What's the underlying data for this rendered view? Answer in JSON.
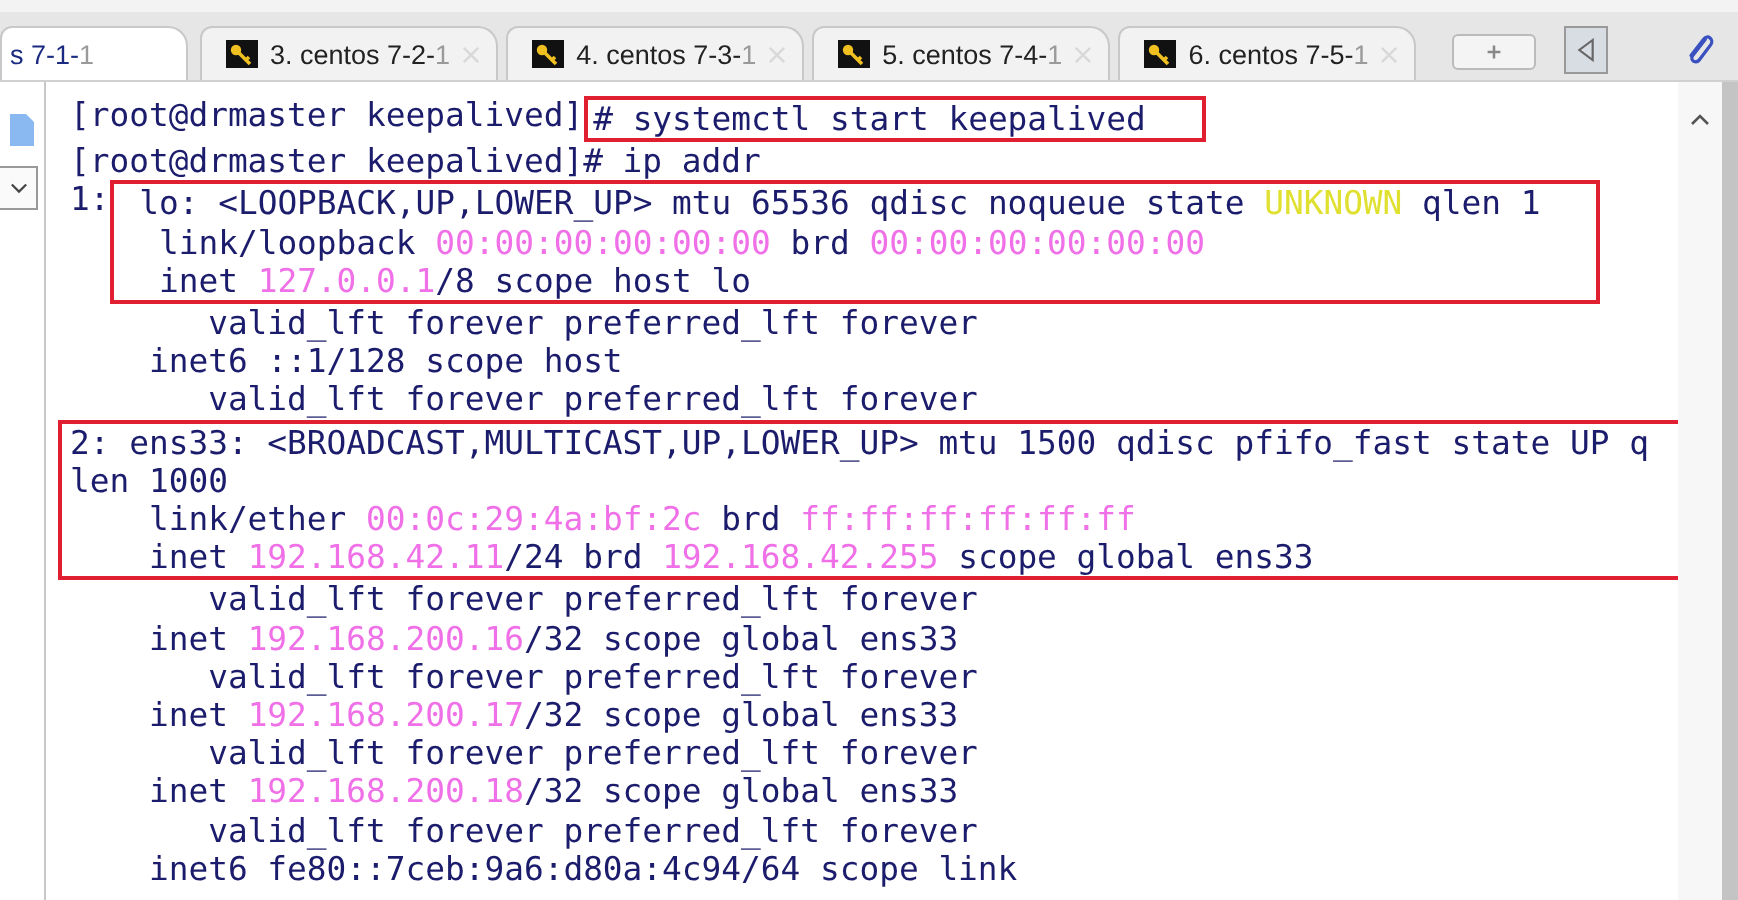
{
  "tabs": [
    {
      "label": "s 7-1-",
      "faded": "1",
      "selected": true,
      "key_icon": false
    },
    {
      "label": "3. centos 7-2-",
      "faded": "1",
      "selected": false,
      "key_icon": true
    },
    {
      "label": "4. centos 7-3-",
      "faded": "1",
      "selected": false,
      "key_icon": true
    },
    {
      "label": "5. centos 7-4-",
      "faded": "1",
      "selected": false,
      "key_icon": true
    },
    {
      "label": "6. centos 7-5-",
      "faded": "1",
      "selected": false,
      "key_icon": true
    }
  ],
  "terminal": {
    "blocks": [
      {
        "highlighted": true,
        "lead": "[root@drmaster keepalived]",
        "lines": [
          [
            {
              "text": "# systemctl start keepalived",
              "kind": "plain"
            }
          ]
        ]
      },
      {
        "highlighted": false,
        "lines": [
          [
            {
              "text": "[root@drmaster keepalived]# ip addr",
              "kind": "plain"
            }
          ]
        ]
      },
      {
        "highlighted": true,
        "lead": "1:",
        "lines": [
          [
            {
              "text": " lo: <LOOPBACK,UP,LOWER_UP> mtu 65536 qdisc noqueue state ",
              "kind": "plain"
            },
            {
              "text": "UNKNOWN",
              "kind": "warn"
            },
            {
              "text": " qlen 1",
              "kind": "plain"
            }
          ],
          [
            {
              "text": "  link/loopback ",
              "kind": "plain"
            },
            {
              "text": "00:00:00:00:00:00",
              "kind": "addr"
            },
            {
              "text": " brd ",
              "kind": "plain"
            },
            {
              "text": "00:00:00:00:00:00",
              "kind": "addr"
            }
          ],
          [
            {
              "text": "  inet ",
              "kind": "plain"
            },
            {
              "text": "127.0.0.1",
              "kind": "addr"
            },
            {
              "text": "/8 scope host lo",
              "kind": "plain"
            }
          ]
        ]
      },
      {
        "highlighted": false,
        "lines": [
          [
            {
              "text": "       valid_lft forever preferred_lft forever",
              "kind": "plain"
            }
          ],
          [
            {
              "text": "    inet6 ::1/128 scope host",
              "kind": "plain"
            }
          ],
          [
            {
              "text": "       valid_lft forever preferred_lft forever",
              "kind": "plain"
            }
          ]
        ]
      },
      {
        "highlighted": true,
        "lines": [
          [
            {
              "text": "2: ens33: <BROADCAST,MULTICAST,UP,LOWER_UP> mtu 1500 qdisc pfifo_fast state UP q",
              "kind": "plain"
            }
          ],
          [
            {
              "text": "len 1000",
              "kind": "plain"
            }
          ],
          [
            {
              "text": "    link/ether ",
              "kind": "plain"
            },
            {
              "text": "00:0c:29:4a:bf:2c",
              "kind": "addr"
            },
            {
              "text": " brd ",
              "kind": "plain"
            },
            {
              "text": "ff:ff:ff:ff:ff:ff",
              "kind": "addr"
            }
          ],
          [
            {
              "text": "    inet ",
              "kind": "plain"
            },
            {
              "text": "192.168.42.11",
              "kind": "addr"
            },
            {
              "text": "/24 brd ",
              "kind": "plain"
            },
            {
              "text": "192.168.42.255",
              "kind": "addr"
            },
            {
              "text": " scope global ens33",
              "kind": "plain"
            }
          ]
        ]
      },
      {
        "highlighted": false,
        "lines": [
          [
            {
              "text": "       valid_lft forever preferred_lft forever",
              "kind": "plain"
            }
          ],
          [
            {
              "text": "    inet ",
              "kind": "plain"
            },
            {
              "text": "192.168.200.16",
              "kind": "addr"
            },
            {
              "text": "/32 scope global ens33",
              "kind": "plain"
            }
          ],
          [
            {
              "text": "       valid_lft forever preferred_lft forever",
              "kind": "plain"
            }
          ],
          [
            {
              "text": "    inet ",
              "kind": "plain"
            },
            {
              "text": "192.168.200.17",
              "kind": "addr"
            },
            {
              "text": "/32 scope global ens33",
              "kind": "plain"
            }
          ],
          [
            {
              "text": "       valid_lft forever preferred_lft forever",
              "kind": "plain"
            }
          ],
          [
            {
              "text": "    inet ",
              "kind": "plain"
            },
            {
              "text": "192.168.200.18",
              "kind": "addr"
            },
            {
              "text": "/32 scope global ens33",
              "kind": "plain"
            }
          ],
          [
            {
              "text": "       valid_lft forever preferred_lft forever",
              "kind": "plain"
            }
          ],
          [
            {
              "text": "    inet6 fe80::7ceb:9a6:d80a:4c94/64 scope link",
              "kind": "plain"
            }
          ]
        ]
      }
    ]
  }
}
